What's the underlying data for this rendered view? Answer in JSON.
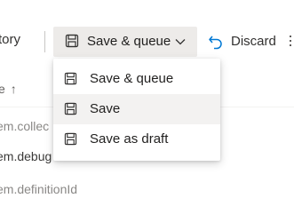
{
  "toolbar": {
    "history_tab_label": "tory",
    "save_queue_label": "Save & queue",
    "discard_label": "Discard"
  },
  "table": {
    "sort_column_label": "e",
    "sort_arrow": "↑",
    "rows": [
      "em.collec",
      "em.debug",
      "em.definitionId"
    ]
  },
  "dropdown": {
    "items": [
      {
        "label": "Save & queue",
        "icon": "save-icon"
      },
      {
        "label": "Save",
        "icon": "save-icon"
      },
      {
        "label": "Save as draft",
        "icon": "save-icon"
      }
    ],
    "hovered_index": 1
  },
  "colors": {
    "button_bg": "#edebe9",
    "hover_bg": "#f3f2f1",
    "accent": "#0078d4",
    "text": "#201f1e"
  }
}
